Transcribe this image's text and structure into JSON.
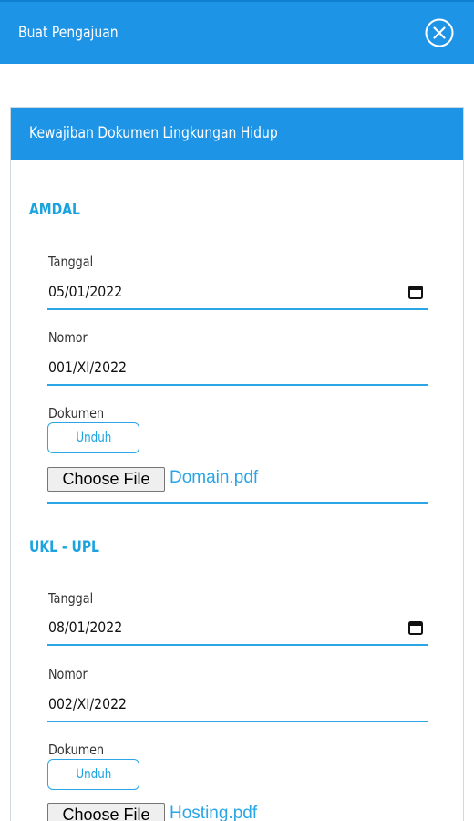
{
  "header": {
    "title": "Buat Pengajuan",
    "close_icon": "close-circle-icon"
  },
  "card": {
    "title": "Kewajiban Dokumen Lingkungan Hidup"
  },
  "sections": [
    {
      "title": "AMDAL",
      "tanggal_label": "Tanggal",
      "tanggal_value": "05/01/2022",
      "nomor_label": "Nomor",
      "nomor_value": "001/XI/2022",
      "dokumen_label": "Dokumen",
      "unduh_label": "Unduh",
      "choose_file_label": "Choose File",
      "file_name": "Domain.pdf"
    },
    {
      "title": "UKL - UPL",
      "tanggal_label": "Tanggal",
      "tanggal_value": "08/01/2022",
      "nomor_label": "Nomor",
      "nomor_value": "002/XI/2022",
      "dokumen_label": "Dokumen",
      "unduh_label": "Unduh",
      "choose_file_label": "Choose File",
      "file_name": "Hosting.pdf"
    }
  ],
  "colors": {
    "primary": "#1e94e6",
    "accent": "#2aa6e6",
    "section_title": "#1aa3df"
  }
}
